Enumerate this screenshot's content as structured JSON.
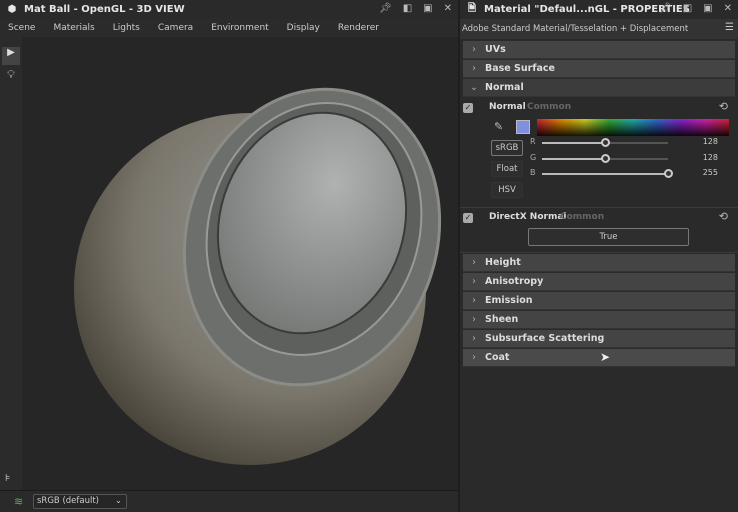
{
  "view3d": {
    "title": "Mat Ball - OpenGL - 3D VIEW",
    "menu": [
      "Scene",
      "Materials",
      "Lights",
      "Camera",
      "Environment",
      "Display",
      "Renderer"
    ],
    "colorspace": "sRGB (default)"
  },
  "props": {
    "title": "Material \"Defaul...nGL - PROPERTIES",
    "subtitle": "Adobe Standard Material/Tesselation + Displacement",
    "sections_top": [
      "UVs",
      "Base Surface"
    ],
    "normal_section": "Normal",
    "normal": {
      "label": "Normal",
      "tag": "Common",
      "swatch": "#8090e0",
      "modes": [
        "sRGB",
        "Float",
        "HSV"
      ],
      "channels": [
        {
          "label": "R",
          "value": "128",
          "frac": 0.5
        },
        {
          "label": "G",
          "value": "128",
          "frac": 0.5
        },
        {
          "label": "B",
          "value": "255",
          "frac": 1.0
        }
      ]
    },
    "directx": {
      "label": "DirectX Normal",
      "tag": "Common",
      "value": "True"
    },
    "sections_bottom": [
      "Height",
      "Anisotropy",
      "Emission",
      "Sheen",
      "Subsurface Scattering",
      "Coat"
    ]
  }
}
